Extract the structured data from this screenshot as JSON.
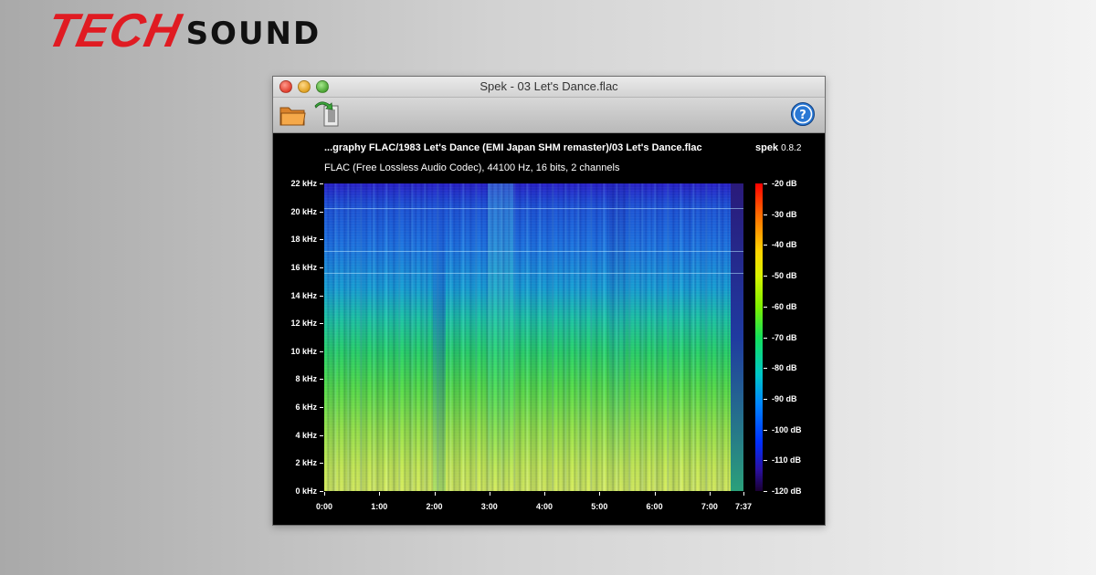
{
  "logo": {
    "part1": "TECH",
    "part2": "SOUND"
  },
  "window": {
    "title": "Spek - 03 Let's Dance.flac",
    "toolbar": {
      "open_icon": "folder-icon",
      "save_icon": "save-icon",
      "help_icon": "help-icon"
    }
  },
  "header": {
    "file_path": "...graphy FLAC/1983 Let's Dance (EMI Japan SHM remaster)/03 Let's Dance.flac",
    "app_name": "spek",
    "app_version": "0.8.2",
    "file_info": "FLAC (Free Lossless Audio Codec), 44100 Hz, 16 bits, 2 channels"
  },
  "chart_data": {
    "type": "heatmap",
    "y_axis_labels": [
      "22 kHz",
      "20 kHz",
      "18 kHz",
      "16 kHz",
      "14 kHz",
      "12 kHz",
      "10 kHz",
      "8 kHz",
      "6 kHz",
      "4 kHz",
      "2 kHz",
      "0 kHz"
    ],
    "x_axis_labels": [
      "0:00",
      "1:00",
      "2:00",
      "3:00",
      "4:00",
      "5:00",
      "6:00",
      "7:00",
      "7:37"
    ],
    "x_seconds": [
      0,
      60,
      120,
      180,
      240,
      300,
      360,
      420,
      457
    ],
    "duration_seconds": 457,
    "ylim_khz": [
      0,
      22
    ],
    "colorbar_labels": [
      "-20 dB",
      "-30 dB",
      "-40 dB",
      "-50 dB",
      "-60 dB",
      "-70 dB",
      "-80 dB",
      "-90 dB",
      "-100 dB",
      "-110 dB",
      "-120 dB"
    ],
    "colorbar_range_db": [
      -120,
      -20
    ]
  }
}
